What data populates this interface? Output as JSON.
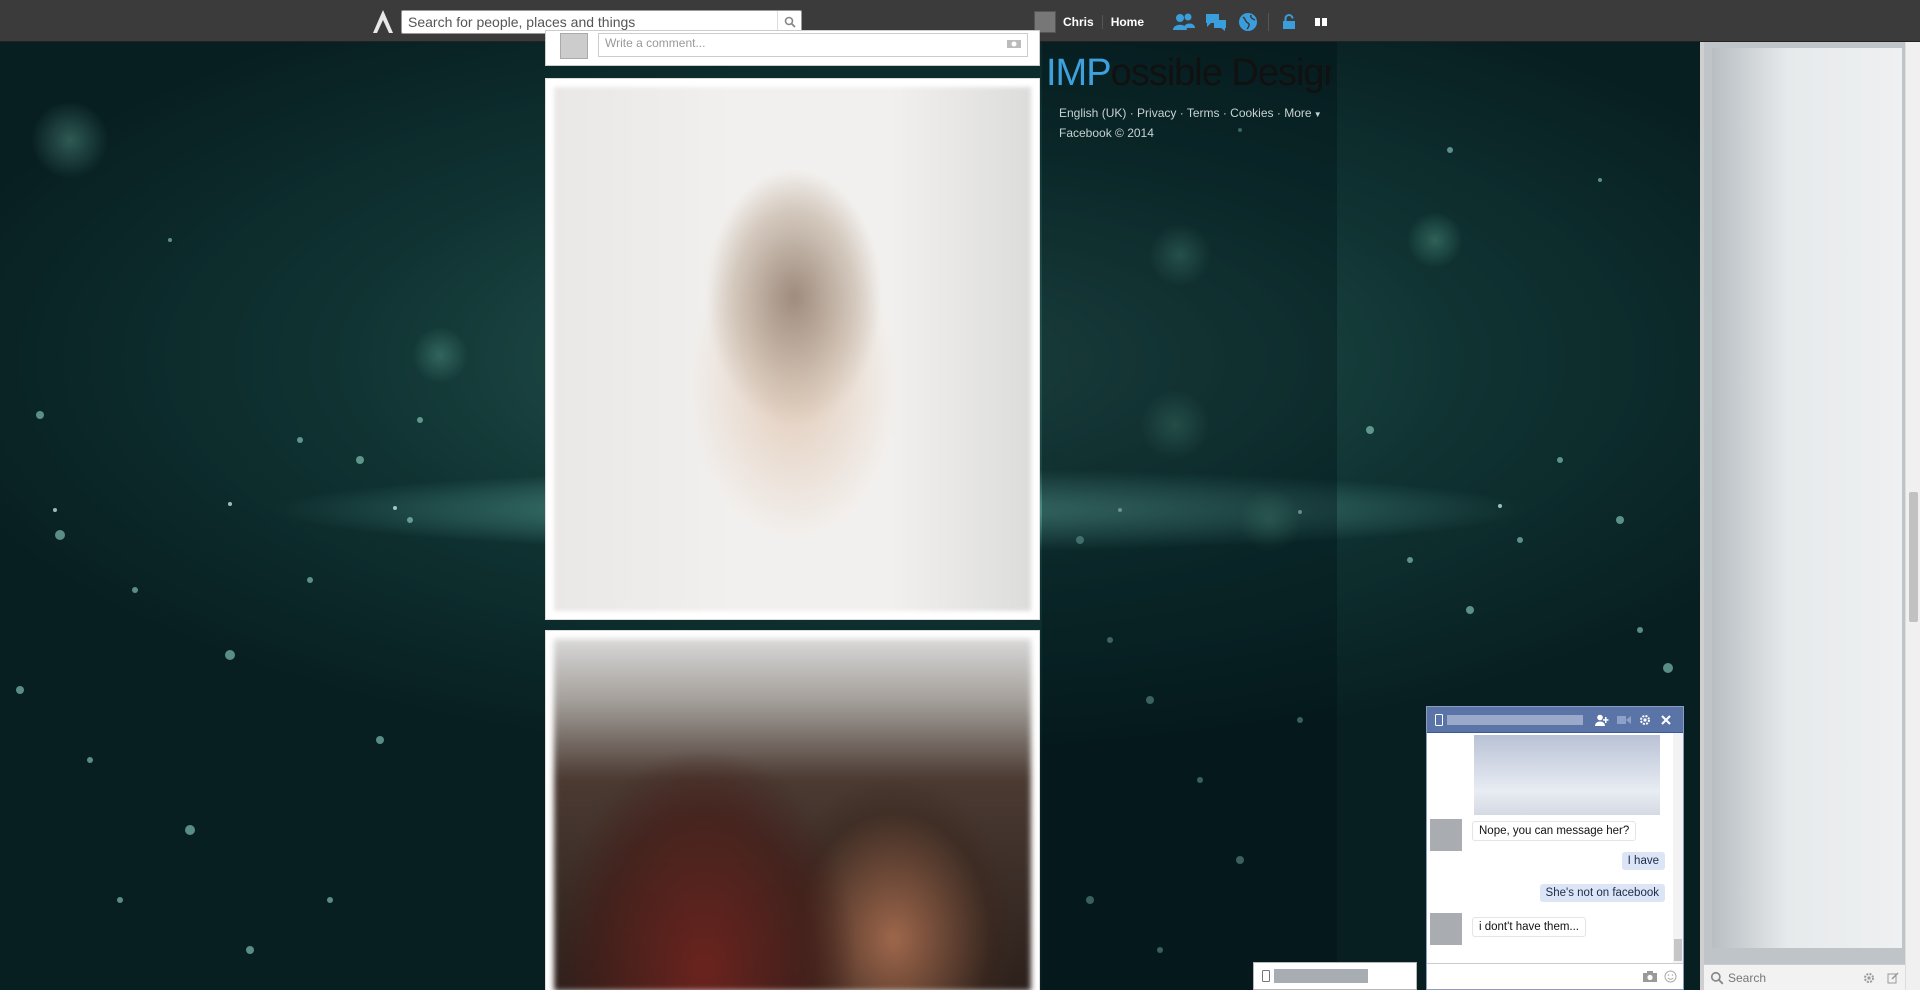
{
  "topbar": {
    "search_placeholder": "Search for people, places and things",
    "user_name": "Chris",
    "home_label": "Home"
  },
  "feed": {
    "comment_placeholder": "Write a comment..."
  },
  "right_column": {
    "brand_highlight": "IMP",
    "brand_rest": "ossible Design",
    "footer_links": [
      "English (UK)",
      "Privacy",
      "Terms",
      "Cookies",
      "More"
    ],
    "footer_copyright": "Facebook © 2014"
  },
  "chat": {
    "messages": [
      {
        "direction": "in",
        "text": "Nope, you can message her?"
      },
      {
        "direction": "out",
        "text": "I have"
      },
      {
        "direction": "out",
        "text": "She's not on facebook"
      },
      {
        "direction": "in",
        "text": "i dont't have them..."
      }
    ]
  },
  "sidebar": {
    "search_placeholder": "Search"
  },
  "colors": {
    "topbar": "#3b3b3b",
    "brand_accent": "#3ea1dd",
    "chat_header": "#5b74a8",
    "outgoing_bubble": "#dce5f5"
  },
  "icons": [
    "assassins-creed-logo-icon",
    "search-icon",
    "friend-requests-icon",
    "messages-icon",
    "notifications-globe-icon",
    "privacy-lock-icon",
    "settings-icon",
    "mobile-icon",
    "add-friend-icon",
    "video-call-icon",
    "gear-icon",
    "close-icon",
    "camera-icon",
    "emoji-icon",
    "compose-icon"
  ]
}
